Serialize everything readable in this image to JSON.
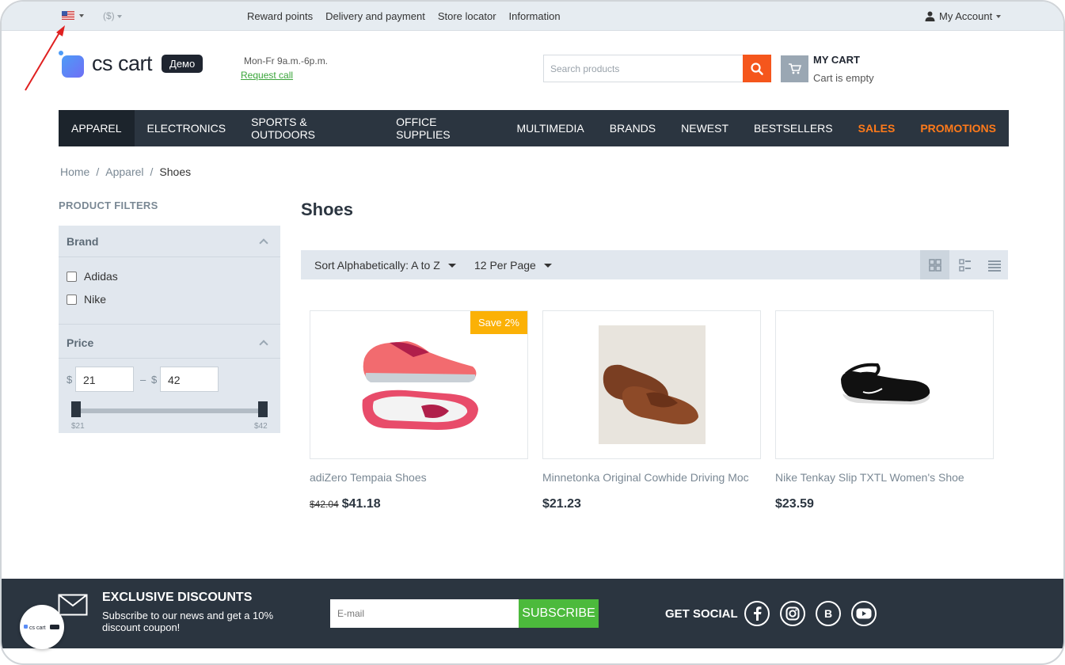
{
  "topbar": {
    "currency": "($)",
    "links": [
      "Reward points",
      "Delivery and payment",
      "Store locator",
      "Information"
    ],
    "account": "My Account"
  },
  "header": {
    "logo_text": "cs cart",
    "logo_badge": "Демо",
    "hours": "Mon-Fr 9a.m.-6p.m.",
    "request_call": "Request call",
    "search_placeholder": "Search products",
    "cart_title": "MY CART",
    "cart_status": "Cart is empty"
  },
  "nav": {
    "items": [
      "APPAREL",
      "ELECTRONICS",
      "SPORTS & OUTDOORS",
      "OFFICE SUPPLIES",
      "MULTIMEDIA",
      "BRANDS",
      "NEWEST",
      "BESTSELLERS",
      "SALES",
      "PROMOTIONS"
    ],
    "active": "APPAREL",
    "highlight_color": "#ff7a1a"
  },
  "breadcrumb": [
    "Home",
    "Apparel",
    "Shoes"
  ],
  "breadcrumb_sep": "/",
  "filters": {
    "title": "PRODUCT FILTERS",
    "brand_label": "Brand",
    "brands": [
      "Adidas",
      "Nike"
    ],
    "price_label": "Price",
    "currency_symbol": "$",
    "range_dash": "–",
    "min_value": "21",
    "max_value": "42",
    "min_label": "$21",
    "max_label": "$42"
  },
  "catalog": {
    "title": "Shoes",
    "sort": "Sort Alphabetically: A to Z",
    "per_page": "12 Per Page",
    "view_modes": [
      "grid-view-icon",
      "list-view-icon",
      "compact-list-icon"
    ],
    "products": [
      {
        "name": "adiZero Tempaia Shoes",
        "old_price": "$42.04",
        "price": "$41.18",
        "badge": "Save 2%"
      },
      {
        "name": "Minnetonka Original Cowhide Driving Moc",
        "price": "$21.23"
      },
      {
        "name": "Nike Tenkay Slip TXTL Women's Shoe",
        "price": "$23.59"
      }
    ]
  },
  "footer": {
    "title": "EXCLUSIVE DISCOUNTS",
    "subtitle": "Subscribe to our news and get a 10% discount coupon!",
    "email_placeholder": "E-mail",
    "subscribe": "SUBSCRIBE",
    "social_title": "GET SOCIAL",
    "social": [
      "facebook-icon",
      "instagram-icon",
      "vk-icon",
      "youtube-icon"
    ],
    "social_vk_glyph": "B"
  },
  "colors": {
    "accent": "#f5561c",
    "nav_bg": "#2b3540",
    "subscribe": "#4cba3c",
    "badge": "#fbb106"
  }
}
